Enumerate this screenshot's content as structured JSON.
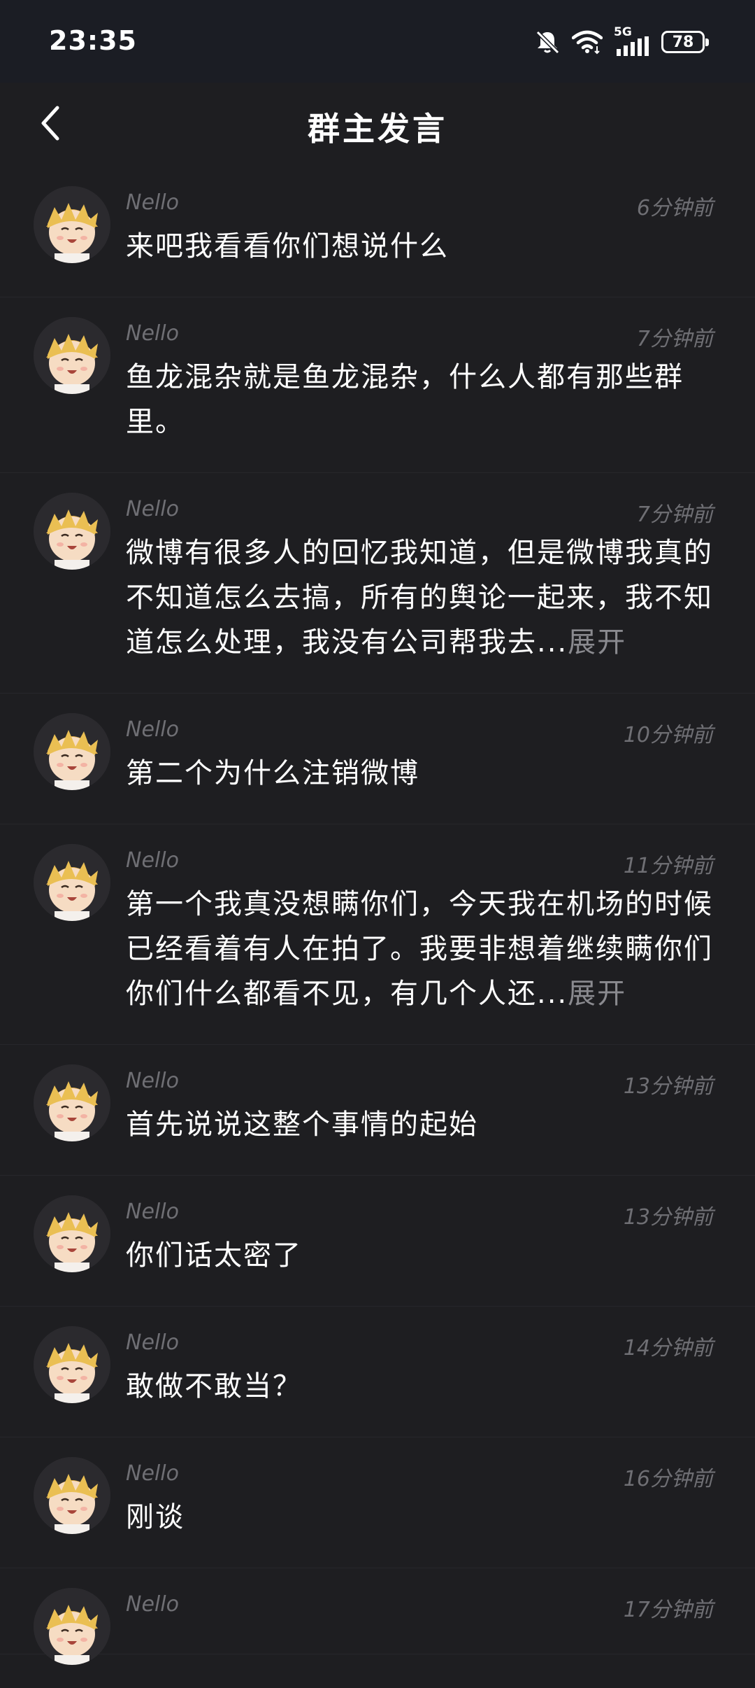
{
  "status_bar": {
    "time": "23:35",
    "network": "5G",
    "battery": "78",
    "icons": [
      "mute-bell-icon",
      "wifi-icon",
      "signal-icon",
      "battery-icon"
    ]
  },
  "header": {
    "title": "群主发言",
    "back_icon": "chevron-left-icon"
  },
  "messages": [
    {
      "name": "Nello",
      "time": "6分钟前",
      "text": "来吧我看看你们想说什么",
      "expand": ""
    },
    {
      "name": "Nello",
      "time": "7分钟前",
      "text": "鱼龙混杂就是鱼龙混杂，什么人都有那些群里。",
      "expand": ""
    },
    {
      "name": "Nello",
      "time": "7分钟前",
      "text": "微博有很多人的回忆我知道，但是微博我真的不知道怎么去搞，所有的舆论一起来，我不知道怎么处理，我没有公司帮我去...",
      "expand": "展开"
    },
    {
      "name": "Nello",
      "time": "10分钟前",
      "text": "第二个为什么注销微博",
      "expand": ""
    },
    {
      "name": "Nello",
      "time": "11分钟前",
      "text": "第一个我真没想瞒你们，今天我在机场的时候已经看着有人在拍了。我要非想着继续瞒你们你们什么都看不见，有几个人还...",
      "expand": "展开"
    },
    {
      "name": "Nello",
      "time": "13分钟前",
      "text": "首先说说这整个事情的起始",
      "expand": ""
    },
    {
      "name": "Nello",
      "time": "13分钟前",
      "text": "你们话太密了",
      "expand": ""
    },
    {
      "name": "Nello",
      "time": "14分钟前",
      "text": "敢做不敢当？",
      "expand": ""
    },
    {
      "name": "Nello",
      "time": "16分钟前",
      "text": "刚谈",
      "expand": ""
    },
    {
      "name": "Nello",
      "time": "17分钟前",
      "text": "",
      "expand": ""
    }
  ],
  "colors": {
    "background": "#1e1e21",
    "status_bar": "#1b1d24",
    "meta_text": "#6f6f74",
    "expand": "#8a8a8f"
  }
}
